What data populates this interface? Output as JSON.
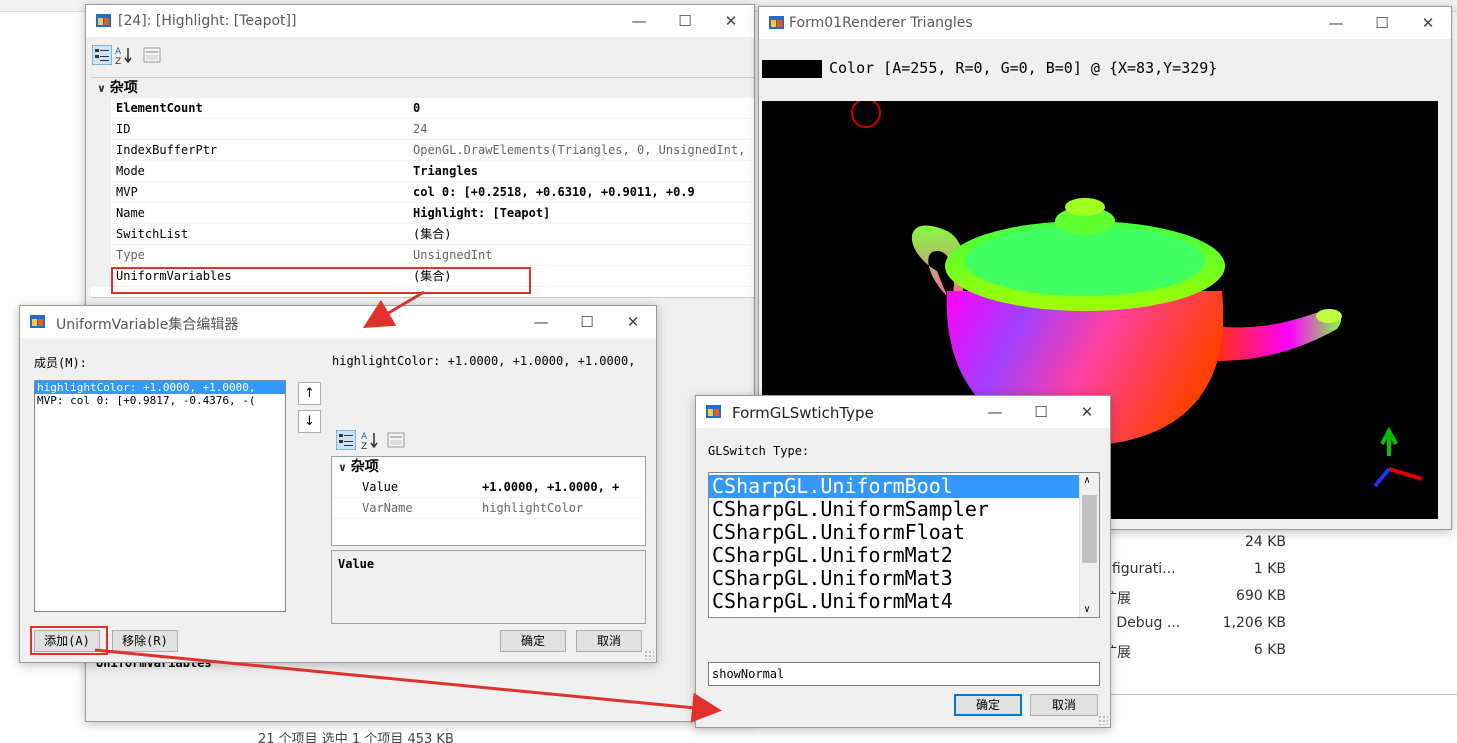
{
  "background": {
    "files": [
      {
        "name": "",
        "size": "24 KB"
      },
      {
        "name": "nfigurati...",
        "size": "1 KB"
      },
      {
        "name": "扩展",
        "size": "690 KB"
      },
      {
        "name": "n Debug ...",
        "size": "1,206 KB"
      },
      {
        "name": "扩展",
        "size": "6 KB"
      }
    ],
    "status": "21 个项目    选中 1 个项目  453 KB"
  },
  "property_window": {
    "title": "[24]: [Highlight: [Teapot]]",
    "category": "杂项",
    "rows": [
      {
        "key": "ElementCount",
        "value": "0",
        "bold": true
      },
      {
        "key": "ID",
        "value": "24",
        "bold": false,
        "dim": true
      },
      {
        "key": "IndexBufferPtr",
        "value": "OpenGL.DrawElements(Triangles, 0, UnsignedInt,",
        "bold": false,
        "dim": true
      },
      {
        "key": "Mode",
        "value": "Triangles",
        "bold": true
      },
      {
        "key": "MVP",
        "value": "col 0: [+0.2518, +0.6310, +0.9011, +0.9",
        "bold": true
      },
      {
        "key": "Name",
        "value": "Highlight: [Teapot]",
        "bold": true
      },
      {
        "key": "SwitchList",
        "value": "(集合)",
        "bold": false
      },
      {
        "key": "Type",
        "value": "UnsignedInt",
        "bold": false,
        "dim": true
      },
      {
        "key": "UniformVariables",
        "value": "(集合)",
        "bold": false
      }
    ],
    "bottom_label": "UniformVariables"
  },
  "renderer_window": {
    "title": "Form01Renderer Triangles",
    "color_label": "Color [A=255, R=0, G=0, B=0] @ {X=83,Y=329}"
  },
  "uniform_editor": {
    "title": "UniformVariable集合编辑器",
    "members_label": "成员(M):",
    "members": [
      "highlightColor: +1.0000, +1.0000,",
      "MVP: col 0: [+0.9817, -0.4376, -("
    ],
    "properties_header": "highlightColor: +1.0000, +1.0000, +1.0000,",
    "category": "杂项",
    "props": [
      {
        "key": "Value",
        "value": "+1.0000, +1.0000, +",
        "bold": true
      },
      {
        "key": "VarName",
        "value": "highlightColor",
        "bold": false
      }
    ],
    "description_title": "Value",
    "add_button": "添加(A)",
    "remove_button": "移除(R)",
    "ok_button": "确定",
    "cancel_button": "取消",
    "up_arrow": "↑",
    "down_arrow": "↓"
  },
  "switch_type_window": {
    "title": "FormGLSwtichType",
    "label": "GLSwitch Type:",
    "types": [
      "CSharpGL.UniformBool",
      "CSharpGL.UniformSampler",
      "CSharpGL.UniformFloat",
      "CSharpGL.UniformMat2",
      "CSharpGL.UniformMat3",
      "CSharpGL.UniformMat4"
    ],
    "selected_index": 0,
    "input_value": "showNormal",
    "ok_button": "确定",
    "cancel_button": "取消"
  },
  "window_controls": {
    "minimize": "—",
    "maximize": "☐",
    "close": "✕"
  },
  "accent": {
    "highlight_box": "#e0322b",
    "selection": "#3399ff"
  }
}
